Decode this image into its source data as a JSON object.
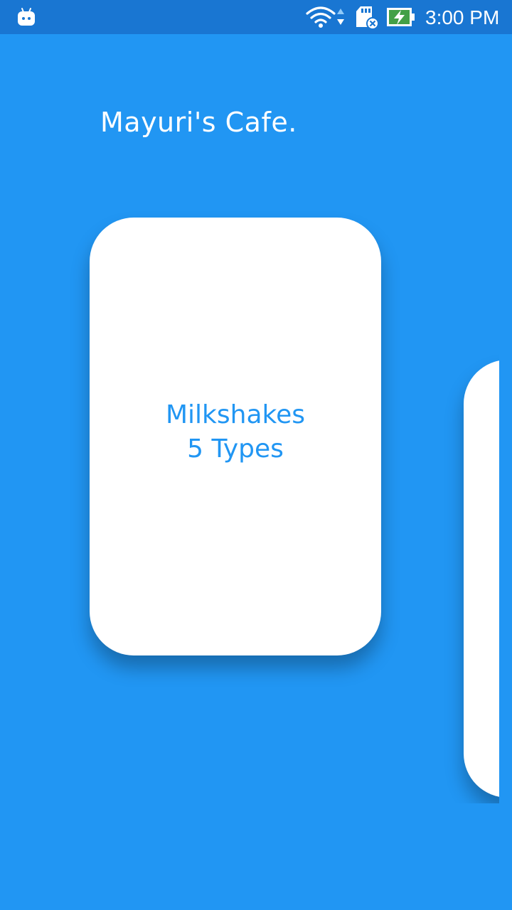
{
  "status_bar": {
    "time": "3:00 PM",
    "icons": [
      "android-icon",
      "wifi-icon",
      "data-arrows-icon",
      "sd-card-icon",
      "battery-charging-icon"
    ],
    "bar_color": "#1976D2"
  },
  "app": {
    "title": "Mayuri's Cafe.",
    "background_color": "#2196F3",
    "accent_color": "#2196F3"
  },
  "carousel": {
    "cards": [
      {
        "title": "Milkshakes",
        "subtitle": "5 Types"
      },
      {
        "title": "",
        "subtitle": ""
      }
    ]
  }
}
